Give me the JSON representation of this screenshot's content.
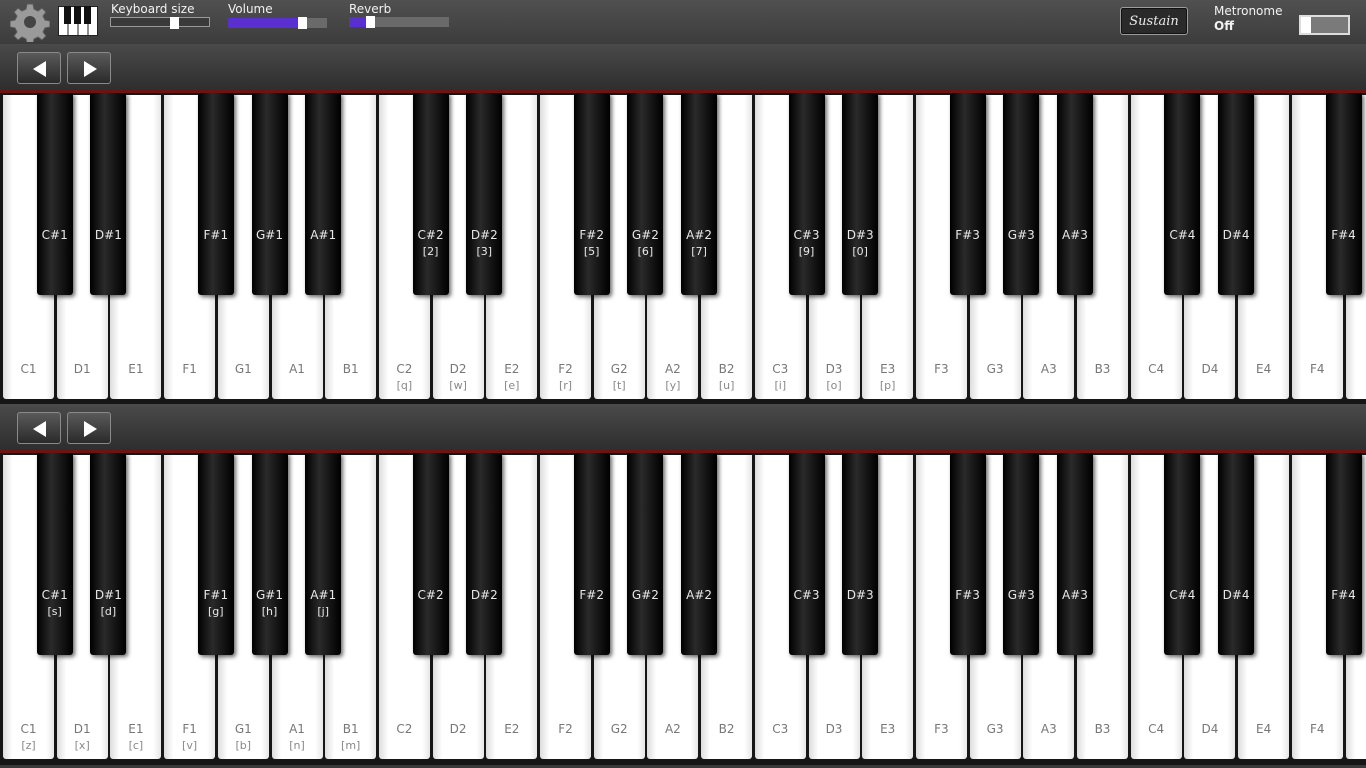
{
  "toolbar": {
    "keyboard_size": {
      "label": "Keyboard  size",
      "value": 0.65
    },
    "volume": {
      "label": "Volume",
      "value": 0.76
    },
    "reverb": {
      "label": "Reverb",
      "value": 0.22
    },
    "sustain_label": "Sustain",
    "metronome": {
      "label": "Metronome",
      "state": "Off"
    }
  },
  "colors": {
    "slider_fill": "#5a2fd0",
    "key_divider": "#6a1414"
  },
  "keyboards": [
    {
      "white_keys": [
        {
          "note": "C1",
          "hint": ""
        },
        {
          "note": "D1",
          "hint": ""
        },
        {
          "note": "E1",
          "hint": ""
        },
        {
          "note": "F1",
          "hint": ""
        },
        {
          "note": "G1",
          "hint": ""
        },
        {
          "note": "A1",
          "hint": ""
        },
        {
          "note": "B1",
          "hint": ""
        },
        {
          "note": "C2",
          "hint": "[q]"
        },
        {
          "note": "D2",
          "hint": "[w]"
        },
        {
          "note": "E2",
          "hint": "[e]"
        },
        {
          "note": "F2",
          "hint": "[r]"
        },
        {
          "note": "G2",
          "hint": "[t]"
        },
        {
          "note": "A2",
          "hint": "[y]"
        },
        {
          "note": "B2",
          "hint": "[u]"
        },
        {
          "note": "C3",
          "hint": "[i]"
        },
        {
          "note": "D3",
          "hint": "[o]"
        },
        {
          "note": "E3",
          "hint": "[p]"
        },
        {
          "note": "F3",
          "hint": ""
        },
        {
          "note": "G3",
          "hint": ""
        },
        {
          "note": "A3",
          "hint": ""
        },
        {
          "note": "B3",
          "hint": ""
        },
        {
          "note": "C4",
          "hint": ""
        },
        {
          "note": "D4",
          "hint": ""
        },
        {
          "note": "E4",
          "hint": ""
        },
        {
          "note": "F4",
          "hint": ""
        },
        {
          "note": "",
          "hint": ""
        }
      ],
      "black_keys": [
        {
          "note": "C#1",
          "hint": ""
        },
        {
          "note": "D#1",
          "hint": ""
        },
        {
          "note": "F#1",
          "hint": ""
        },
        {
          "note": "G#1",
          "hint": ""
        },
        {
          "note": "A#1",
          "hint": ""
        },
        {
          "note": "C#2",
          "hint": "[2]"
        },
        {
          "note": "D#2",
          "hint": "[3]"
        },
        {
          "note": "F#2",
          "hint": "[5]"
        },
        {
          "note": "G#2",
          "hint": "[6]"
        },
        {
          "note": "A#2",
          "hint": "[7]"
        },
        {
          "note": "C#3",
          "hint": "[9]"
        },
        {
          "note": "D#3",
          "hint": "[0]"
        },
        {
          "note": "F#3",
          "hint": ""
        },
        {
          "note": "G#3",
          "hint": ""
        },
        {
          "note": "A#3",
          "hint": ""
        },
        {
          "note": "C#4",
          "hint": ""
        },
        {
          "note": "D#4",
          "hint": ""
        },
        {
          "note": "F#4",
          "hint": ""
        }
      ]
    },
    {
      "white_keys": [
        {
          "note": "C1",
          "hint": "[z]"
        },
        {
          "note": "D1",
          "hint": "[x]"
        },
        {
          "note": "E1",
          "hint": "[c]"
        },
        {
          "note": "F1",
          "hint": "[v]"
        },
        {
          "note": "G1",
          "hint": "[b]"
        },
        {
          "note": "A1",
          "hint": "[n]"
        },
        {
          "note": "B1",
          "hint": "[m]"
        },
        {
          "note": "C2",
          "hint": ""
        },
        {
          "note": "D2",
          "hint": ""
        },
        {
          "note": "E2",
          "hint": ""
        },
        {
          "note": "F2",
          "hint": ""
        },
        {
          "note": "G2",
          "hint": ""
        },
        {
          "note": "A2",
          "hint": ""
        },
        {
          "note": "B2",
          "hint": ""
        },
        {
          "note": "C3",
          "hint": ""
        },
        {
          "note": "D3",
          "hint": ""
        },
        {
          "note": "E3",
          "hint": ""
        },
        {
          "note": "F3",
          "hint": ""
        },
        {
          "note": "G3",
          "hint": ""
        },
        {
          "note": "A3",
          "hint": ""
        },
        {
          "note": "B3",
          "hint": ""
        },
        {
          "note": "C4",
          "hint": ""
        },
        {
          "note": "D4",
          "hint": ""
        },
        {
          "note": "E4",
          "hint": ""
        },
        {
          "note": "F4",
          "hint": ""
        },
        {
          "note": "",
          "hint": ""
        }
      ],
      "black_keys": [
        {
          "note": "C#1",
          "hint": "[s]"
        },
        {
          "note": "D#1",
          "hint": "[d]"
        },
        {
          "note": "F#1",
          "hint": "[g]"
        },
        {
          "note": "G#1",
          "hint": "[h]"
        },
        {
          "note": "A#1",
          "hint": "[j]"
        },
        {
          "note": "C#2",
          "hint": ""
        },
        {
          "note": "D#2",
          "hint": ""
        },
        {
          "note": "F#2",
          "hint": ""
        },
        {
          "note": "G#2",
          "hint": ""
        },
        {
          "note": "A#2",
          "hint": ""
        },
        {
          "note": "C#3",
          "hint": ""
        },
        {
          "note": "D#3",
          "hint": ""
        },
        {
          "note": "F#3",
          "hint": ""
        },
        {
          "note": "G#3",
          "hint": ""
        },
        {
          "note": "A#3",
          "hint": ""
        },
        {
          "note": "C#4",
          "hint": ""
        },
        {
          "note": "D#4",
          "hint": ""
        },
        {
          "note": "F#4",
          "hint": ""
        }
      ]
    }
  ]
}
